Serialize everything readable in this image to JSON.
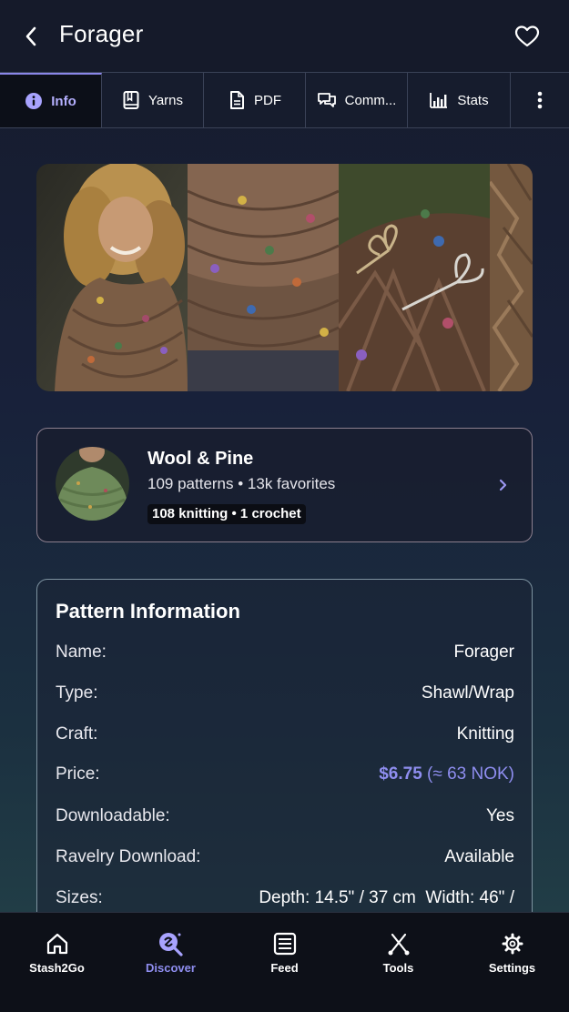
{
  "header": {
    "title": "Forager"
  },
  "tabs": [
    {
      "label": "Info",
      "icon": "info-icon",
      "active": true
    },
    {
      "label": "Yarns",
      "icon": "book-icon",
      "active": false
    },
    {
      "label": "PDF",
      "icon": "document-icon",
      "active": false
    },
    {
      "label": "Comm...",
      "icon": "comments-icon",
      "active": false
    },
    {
      "label": "Stats",
      "icon": "stats-icon",
      "active": false
    },
    {
      "label": "",
      "icon": "more-vertical-icon",
      "active": false
    }
  ],
  "designer": {
    "name": "Wool & Pine",
    "stats": "109 patterns • 13k favorites",
    "badge": "108 knitting • 1 crochet"
  },
  "pattern_info": {
    "title": "Pattern Information",
    "rows": [
      {
        "label": "Name:",
        "value": "Forager"
      },
      {
        "label": "Type:",
        "value": "Shawl/Wrap"
      },
      {
        "label": "Craft:",
        "value": "Knitting"
      },
      {
        "label": "Price:",
        "value": "$6.75",
        "value_extra": " (≈ 63 NOK)"
      },
      {
        "label": "Downloadable:",
        "value": "Yes"
      },
      {
        "label": "Ravelry Download:",
        "value": "Available"
      },
      {
        "label": "Sizes:",
        "value": "Depth: 14.5\" / 37 cm  Width: 46\" /"
      }
    ]
  },
  "bottom_nav": [
    {
      "label": "Stash2Go",
      "icon": "home-icon",
      "active": false
    },
    {
      "label": "Discover",
      "icon": "discover-icon",
      "active": true
    },
    {
      "label": "Feed",
      "icon": "feed-icon",
      "active": false
    },
    {
      "label": "Tools",
      "icon": "tools-icon",
      "active": false
    },
    {
      "label": "Settings",
      "icon": "settings-icon",
      "active": false
    }
  ],
  "colors": {
    "accent": "#8f8ef0",
    "header_bg": "#151a2a",
    "card_border": "#8c7f8e"
  }
}
